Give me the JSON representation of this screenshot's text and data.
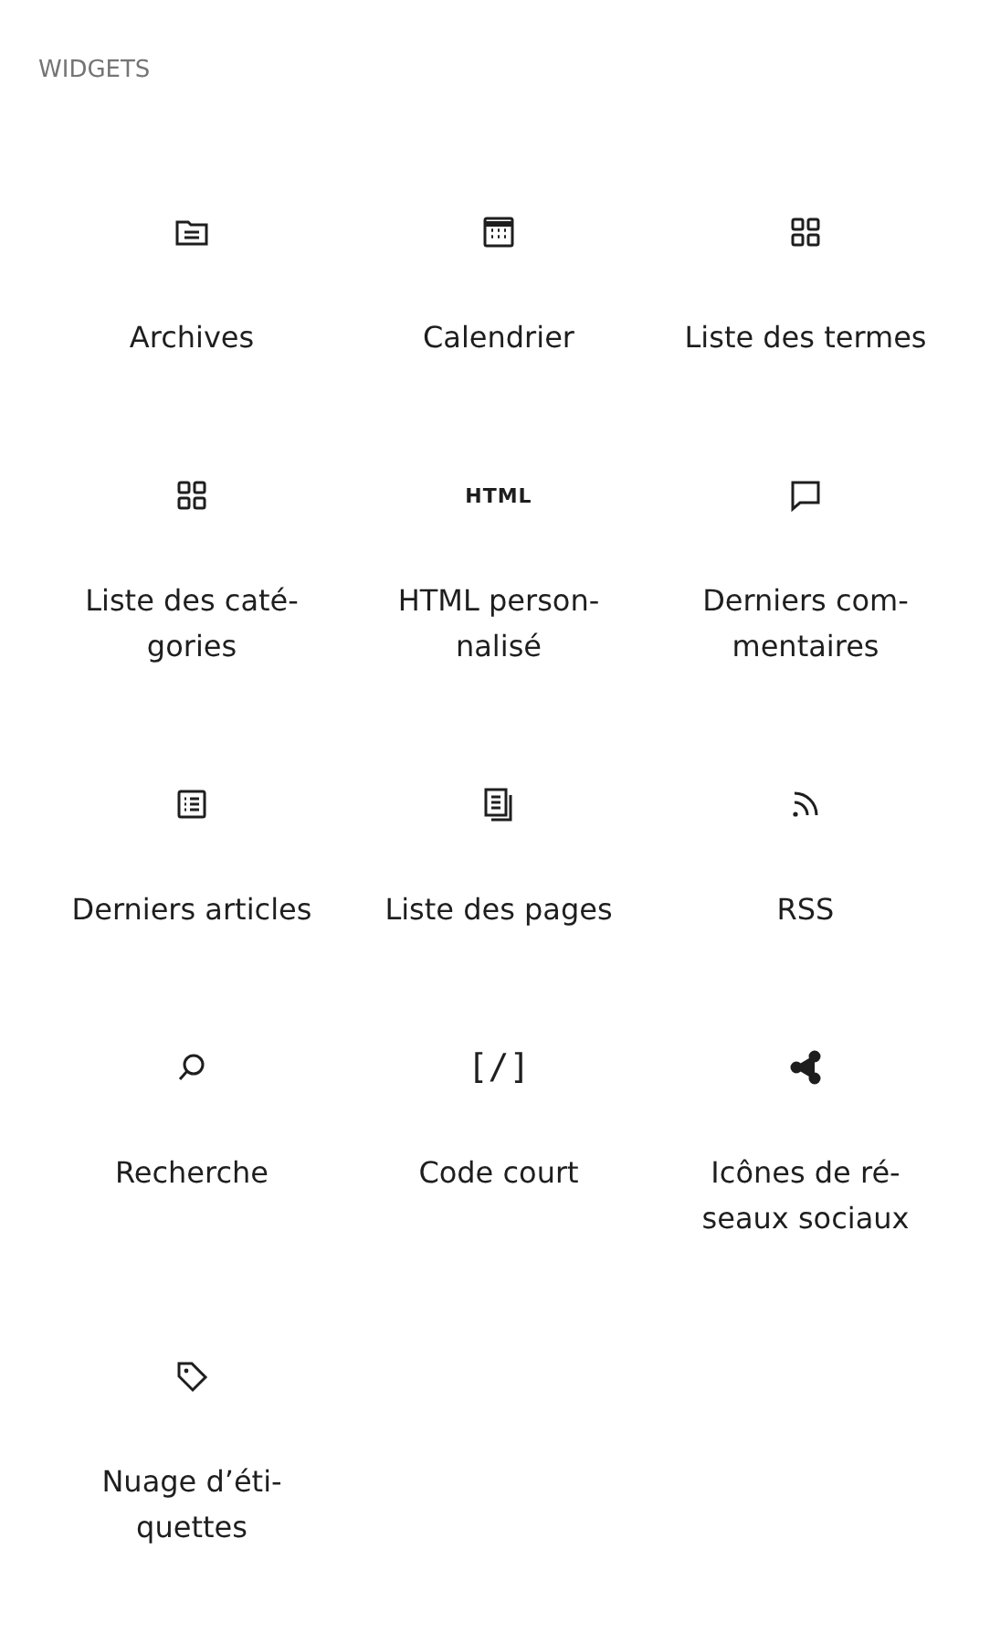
{
  "section": {
    "title": "WIDGETS"
  },
  "blocks": [
    {
      "kind": "archive",
      "label": [
        "Archives"
      ]
    },
    {
      "kind": "calendar",
      "label": [
        "Calendrier"
      ]
    },
    {
      "kind": "grid",
      "label": [
        "Liste des termes"
      ]
    },
    {
      "kind": "grid",
      "label": [
        "Liste des caté-",
        "gories"
      ]
    },
    {
      "kind": "html",
      "icon_text": "HTML",
      "label": [
        "HTML person-",
        "nalisé"
      ]
    },
    {
      "kind": "comment",
      "label": [
        "Derniers com-",
        "mentaires"
      ]
    },
    {
      "kind": "list",
      "label": [
        "Derniers articles"
      ]
    },
    {
      "kind": "pages",
      "label": [
        "Liste des pages"
      ]
    },
    {
      "kind": "rss",
      "label": [
        "RSS"
      ]
    },
    {
      "kind": "search",
      "label": [
        "Recherche"
      ]
    },
    {
      "kind": "shortcode",
      "icon_text": "[/]",
      "label": [
        "Code court"
      ]
    },
    {
      "kind": "share",
      "label": [
        "Icônes de ré-",
        "seaux sociaux"
      ]
    },
    {
      "kind": "tag",
      "label": [
        "Nuage d’éti-",
        "quettes"
      ]
    }
  ]
}
